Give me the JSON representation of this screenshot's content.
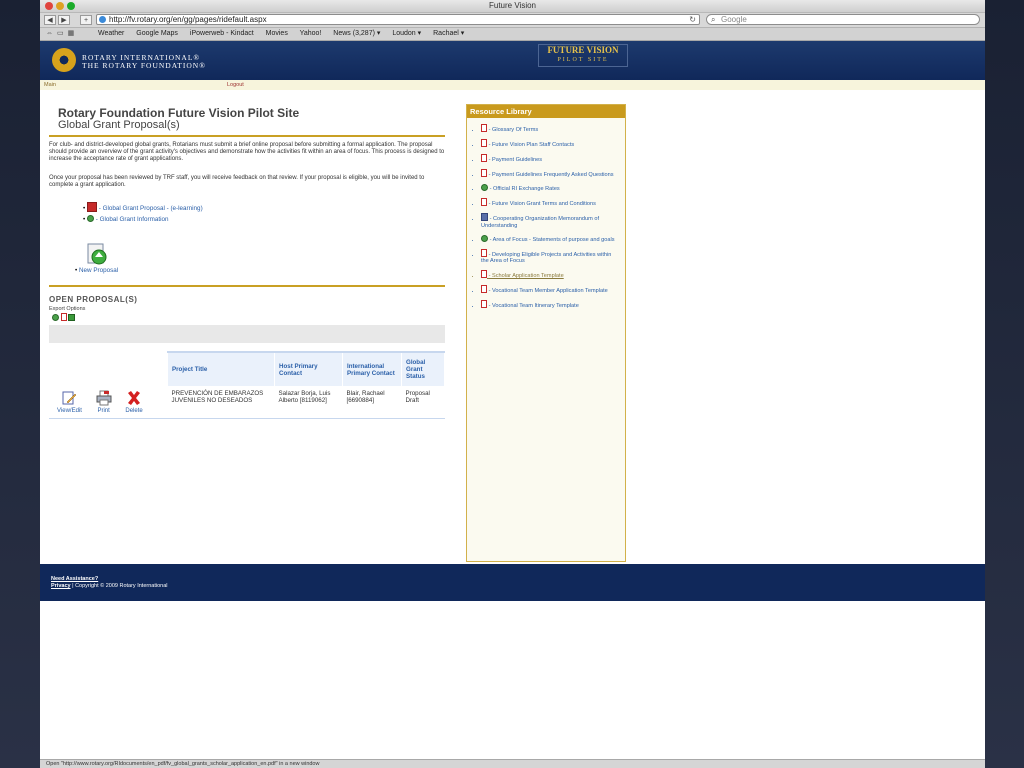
{
  "window": {
    "title": "Future Vision"
  },
  "toolbar": {
    "url": "http://fv.rotary.org/en/gg/pages/ridefault.aspx",
    "search_placeholder": "Google",
    "back": "◀",
    "forward": "▶",
    "add": "+"
  },
  "bookmarks": [
    "Weather",
    "Google Maps",
    "iPowerweb - Kindact",
    "Movies",
    "Yahoo!",
    "News (3,287) ▾",
    "Loudon ▾",
    "Rachael ▾"
  ],
  "header": {
    "logo_line1": "ROTARY INTERNATIONAL®",
    "logo_line2": "THE ROTARY FOUNDATION®",
    "fv_line1": "FUTURE VISION",
    "fv_line2": "PILOT SITE"
  },
  "subnav": {
    "main": "Main",
    "logout": "Logout"
  },
  "page": {
    "title": "Rotary Foundation Future Vision Pilot Site",
    "subtitle": "Global Grant Proposal(s)",
    "intro1": "For club- and district-developed global grants, Rotarians must submit a brief online proposal before submitting a formal application. The proposal should provide an overview of the grant activity's objectives and demonstrate how the activities fit within an area of focus. This process is designed to increase the acceptance rate of grant applications.",
    "intro2": "Once your proposal has been reviewed by TRF staff, you will receive feedback on that review. If your proposal is eligible, you will be invited to complete a grant application.",
    "link_elearning": "- Global Grant Proposal - (e-learning)",
    "link_info": "- Global Grant Information",
    "new_proposal": "New Proposal",
    "open_proposals": "OPEN PROPOSAL(S)",
    "export_options": "Export Options"
  },
  "table": {
    "headers": [
      "Project Title",
      "Host Primary Contact",
      "International Primary Contact",
      "Global Grant Status"
    ],
    "actions": {
      "view": "View/Edit",
      "print": "Print",
      "delete": "Delete"
    },
    "row": {
      "title": "PREVENCIÓN DE EMBARAZOS JUVENILES NO DESEADOS",
      "host": "Salazar Borja, Luis Alberto [8119062]",
      "intl": "Blair, Rachael [6690884]",
      "status": "Proposal Draft"
    }
  },
  "sidebar": {
    "title": "Resource Library",
    "items": [
      "- Glossary Of Terms",
      "- Future Vision Plan Staff Contacts",
      "- Payment Guidelines",
      "- Payment Guidelines Frequently Asked Questions",
      "- Official RI Exchange Rates",
      "- Future Vision Grant Terms and Conditions",
      "- Cooperating Organization Memorandum of Understanding",
      "- Area of Focus - Statements of purpose and goals",
      "- Developing Eligible Projects and Activities within the Area of Focus",
      "- Scholar Application Template",
      "- Vocational Team Member Application Template",
      "- Vocational Team Itinerary Template"
    ]
  },
  "footer": {
    "assist": "Need Assistance?",
    "privacy": "Privacy",
    "copyright": " | Copyright © 2009 Rotary International"
  },
  "status": {
    "text": "Open \"http://www.rotary.org/RIdocuments/en_pdf/fv_global_grants_scholar_application_en.pdf\" in a new window"
  }
}
